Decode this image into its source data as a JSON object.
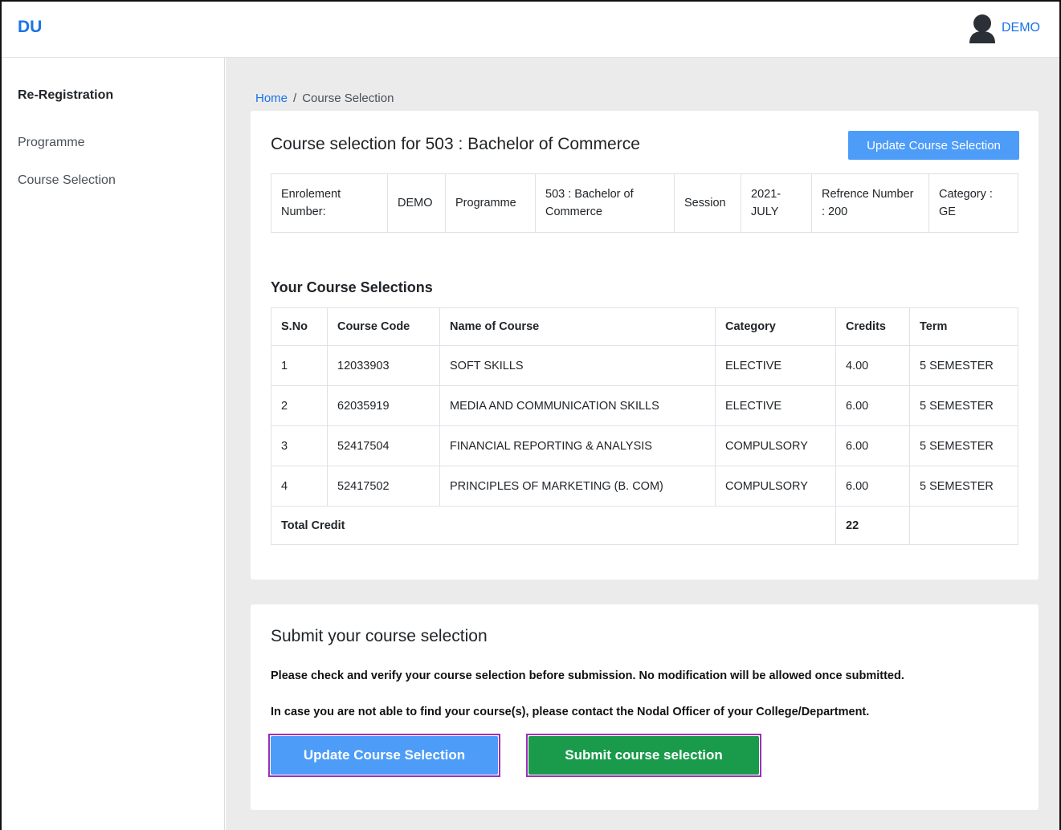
{
  "header": {
    "brand": "DU",
    "user_name": "DEMO"
  },
  "sidebar": {
    "title": "Re-Registration",
    "items": [
      {
        "label": "Programme"
      },
      {
        "label": "Course Selection"
      }
    ]
  },
  "breadcrumb": {
    "home": "Home",
    "separator": "/",
    "current": "Course Selection"
  },
  "selection_card": {
    "title": "Course selection for 503 : Bachelor of Commerce",
    "update_button": "Update Course Selection",
    "info": {
      "enrolment_label": "Enrolement Number:",
      "enrolment_value": "DEMO",
      "programme_label": "Programme",
      "programme_value": "503 : Bachelor of Commerce",
      "session_label": "Session",
      "session_value": "2021-JULY",
      "reference": "Refrence Number : 200",
      "category": "Category : GE"
    },
    "courses_heading": "Your Course Selections",
    "columns": [
      "S.No",
      "Course Code",
      "Name of Course",
      "Category",
      "Credits",
      "Term"
    ],
    "rows": [
      {
        "sno": "1",
        "code": "12033903",
        "name": "SOFT SKILLS",
        "category": "ELECTIVE",
        "credits": "4.00",
        "term": "5 SEMESTER"
      },
      {
        "sno": "2",
        "code": "62035919",
        "name": "MEDIA AND COMMUNICATION SKILLS",
        "category": "ELECTIVE",
        "credits": "6.00",
        "term": "5 SEMESTER"
      },
      {
        "sno": "3",
        "code": "52417504",
        "name": "FINANCIAL REPORTING & ANALYSIS",
        "category": "COMPULSORY",
        "credits": "6.00",
        "term": "5 SEMESTER"
      },
      {
        "sno": "4",
        "code": "52417502",
        "name": "PRINCIPLES OF MARKETING (B. COM)",
        "category": "COMPULSORY",
        "credits": "6.00",
        "term": "5 SEMESTER"
      }
    ],
    "total_label": "Total Credit",
    "total_value": "22"
  },
  "submit_card": {
    "title": "Submit your course selection",
    "notice_1": "Please check and verify your course selection before submission. No modification will be allowed once submitted.",
    "notice_2": "In case you are not able to find your course(s), please contact the Nodal Officer of your College/Department.",
    "update_button": "Update Course Selection",
    "submit_button": "Submit course selection"
  },
  "colors": {
    "brand": "#1a73e8",
    "primary_button": "#4d9cf8",
    "success_button": "#1a9b4b",
    "highlight_outline": "#9b30b8",
    "main_background": "#ebebeb"
  }
}
